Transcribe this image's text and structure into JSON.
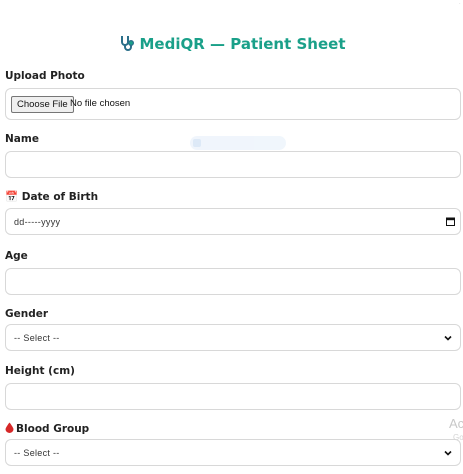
{
  "header": {
    "title": "MediQR — Patient Sheet",
    "logo_icon": "stethoscope-icon",
    "color": "#1aa089"
  },
  "upload": {
    "label": "Upload Photo",
    "button": "Choose File",
    "status": "No file chosen"
  },
  "name": {
    "label": "Name",
    "value": ""
  },
  "dob": {
    "label": "📅 Date of Birth",
    "placeholder": "dd-----yyyy",
    "icon": "calendar-icon"
  },
  "age": {
    "label": "Age",
    "value": ""
  },
  "gender": {
    "label": "Gender",
    "selected": "-- Select --"
  },
  "height": {
    "label": "Height (cm)",
    "value": ""
  },
  "blood": {
    "label": "Blood Group",
    "icon": "blood-drop-icon",
    "selected": "-- Select --"
  },
  "watermark": {
    "line1": "Ac",
    "line2": "Go"
  }
}
